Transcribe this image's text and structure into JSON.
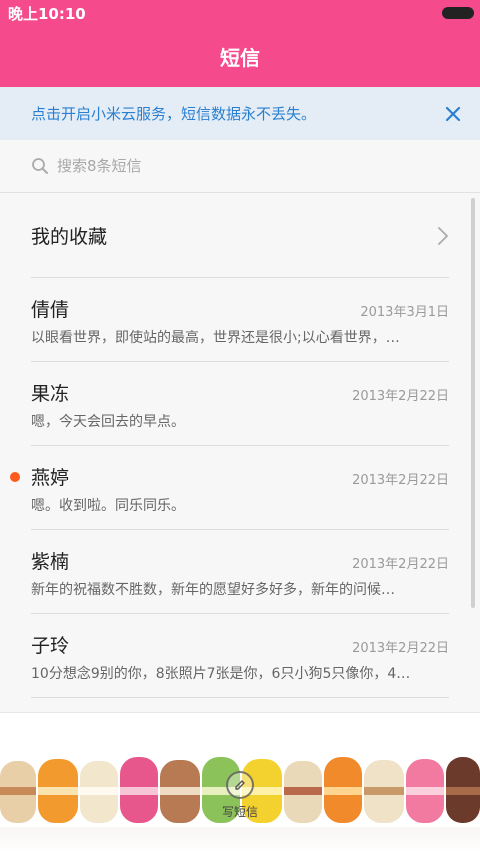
{
  "status_bar": {
    "time": "晚上10:10"
  },
  "header": {
    "title": "短信"
  },
  "cloud_banner": {
    "text": "点击开启小米云服务，短信数据永不丢失。"
  },
  "search": {
    "placeholder": "搜索8条短信"
  },
  "favorites": {
    "label": "我的收藏"
  },
  "conversations": [
    {
      "name": "倩倩",
      "date": "2013年3月1日",
      "preview": "以眼看世界，即使站的最高，世界还是很小;以心看世界，…",
      "unread": false
    },
    {
      "name": "果冻",
      "date": "2013年2月22日",
      "preview": "嗯，今天会回去的早点。",
      "unread": false
    },
    {
      "name": "燕婷",
      "date": "2013年2月22日",
      "preview": "嗯。收到啦。同乐同乐。",
      "unread": true
    },
    {
      "name": "紫楠",
      "date": "2013年2月22日",
      "preview": "新年的祝福数不胜数，新年的愿望好多好多，新年的问候…",
      "unread": false
    },
    {
      "name": "子玲",
      "date": "2013年2月22日",
      "preview": "10分想念9别的你，8张照片7张是你，6只小狗5只像你，4…",
      "unread": false
    }
  ],
  "compose": {
    "label": "写短信"
  },
  "colors": {
    "header_bg": "#f54a8c",
    "banner_bg": "#e4edf6",
    "banner_text": "#2a7fd0",
    "unread_dot": "#ff5a1e"
  },
  "icons": {
    "status": "battery-icon",
    "banner": "close-icon",
    "search": "search-icon",
    "favorites": "chevron-right-icon",
    "compose": "compose-icon"
  }
}
